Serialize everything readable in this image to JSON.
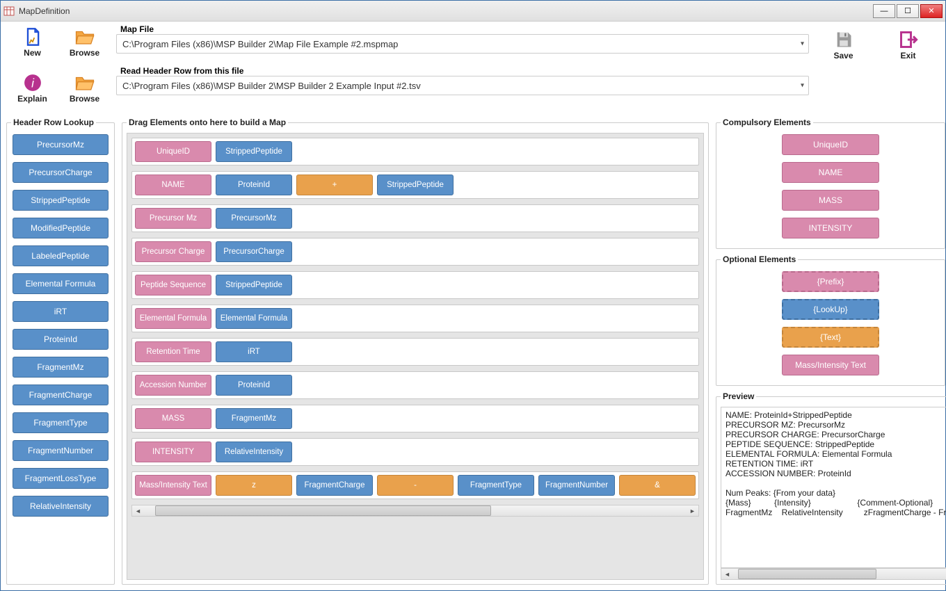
{
  "window_title": "MapDefinition",
  "toolbar": {
    "new": "New",
    "browse": "Browse",
    "explain": "Explain",
    "save": "Save",
    "exit": "Exit"
  },
  "fields": {
    "map_file_label": "Map File",
    "map_file_value": "C:\\Program Files (x86)\\MSP Builder 2\\Map File Example #2.mspmap",
    "header_file_label": "Read Header Row from this file",
    "header_file_value": "C:\\Program Files (x86)\\MSP Builder 2\\MSP Builder 2 Example Input #2.tsv"
  },
  "header_lookup": {
    "legend": "Header Row Lookup",
    "items": [
      "PrecursorMz",
      "PrecursorCharge",
      "StrippedPeptide",
      "ModifiedPeptide",
      "LabeledPeptide",
      "Elemental Formula",
      "iRT",
      "ProteinId",
      "FragmentMz",
      "FragmentCharge",
      "FragmentType",
      "FragmentNumber",
      "FragmentLossType",
      "RelativeIntensity"
    ]
  },
  "build": {
    "legend": "Drag Elements onto here to build a Map",
    "rows": [
      [
        {
          "t": "UniqueID",
          "c": "pink"
        },
        {
          "t": "StrippedPeptide",
          "c": "blue"
        }
      ],
      [
        {
          "t": "NAME",
          "c": "pink"
        },
        {
          "t": "ProteinId",
          "c": "blue"
        },
        {
          "t": "+",
          "c": "orange"
        },
        {
          "t": "StrippedPeptide",
          "c": "blue"
        }
      ],
      [
        {
          "t": "Precursor Mz",
          "c": "pink"
        },
        {
          "t": "PrecursorMz",
          "c": "blue"
        }
      ],
      [
        {
          "t": "Precursor Charge",
          "c": "pink"
        },
        {
          "t": "PrecursorCharge",
          "c": "blue"
        }
      ],
      [
        {
          "t": "Peptide Sequence",
          "c": "pink"
        },
        {
          "t": "StrippedPeptide",
          "c": "blue"
        }
      ],
      [
        {
          "t": "Elemental Formula",
          "c": "pink"
        },
        {
          "t": "Elemental Formula",
          "c": "blue"
        }
      ],
      [
        {
          "t": "Retention Time",
          "c": "pink"
        },
        {
          "t": "iRT",
          "c": "blue"
        }
      ],
      [
        {
          "t": "Accession Number",
          "c": "pink"
        },
        {
          "t": "ProteinId",
          "c": "blue"
        }
      ],
      [
        {
          "t": "MASS",
          "c": "pink"
        },
        {
          "t": "FragmentMz",
          "c": "blue"
        }
      ],
      [
        {
          "t": "INTENSITY",
          "c": "pink"
        },
        {
          "t": "RelativeIntensity",
          "c": "blue"
        }
      ],
      [
        {
          "t": "Mass/Intensity Text",
          "c": "pink"
        },
        {
          "t": "z",
          "c": "orange"
        },
        {
          "t": "FragmentCharge",
          "c": "blue"
        },
        {
          "t": "-",
          "c": "orange"
        },
        {
          "t": "FragmentType",
          "c": "blue"
        },
        {
          "t": "FragmentNumber",
          "c": "blue"
        },
        {
          "t": "&",
          "c": "orange"
        }
      ]
    ]
  },
  "compulsory": {
    "legend": "Compulsory Elements",
    "items": [
      "UniqueID",
      "NAME",
      "MASS",
      "INTENSITY"
    ]
  },
  "optional": {
    "legend": "Optional Elements",
    "items": [
      {
        "t": "{Prefix}",
        "c": "pink",
        "dashed": true
      },
      {
        "t": "{LookUp}",
        "c": "blue",
        "dashed": true
      },
      {
        "t": "{Text}",
        "c": "orange",
        "dashed": true
      },
      {
        "t": "Mass/Intensity Text",
        "c": "pink",
        "dashed": false
      }
    ]
  },
  "preview": {
    "legend": "Preview",
    "text": "NAME: ProteinId+StrippedPeptide\nPRECURSOR MZ: PrecursorMz\nPRECURSOR CHARGE: PrecursorCharge\nPEPTIDE SEQUENCE: StrippedPeptide\nELEMENTAL FORMULA: Elemental Formula\nRETENTION TIME: iRT\nACCESSION NUMBER: ProteinId\n\nNum Peaks: {From your data}\n{Mass}          {Intensity}                    {Comment-Optional}\nFragmentMz    RelativeIntensity         zFragmentCharge - FragmentType"
  }
}
